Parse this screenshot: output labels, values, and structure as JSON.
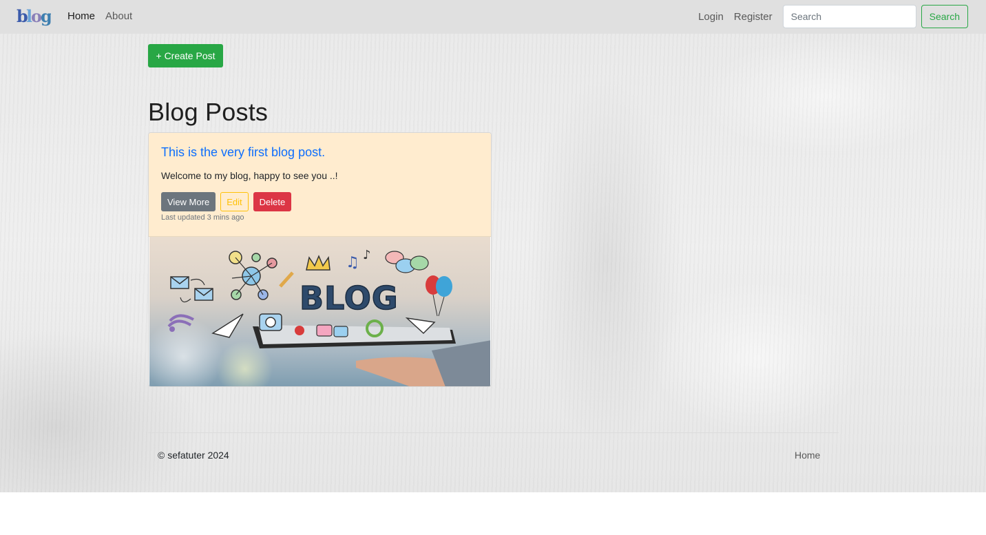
{
  "brand": {
    "logo_text": "blog",
    "logo_colors": [
      "#3b5bab",
      "#e4c44a",
      "#2f6fd0",
      "#d83c3c",
      "#3e9c4a"
    ]
  },
  "nav": {
    "home": "Home",
    "about": "About",
    "login": "Login",
    "register": "Register",
    "search_placeholder": "Search",
    "search_button": "Search"
  },
  "main": {
    "create_button": "+ Create Post",
    "title": "Blog Posts"
  },
  "posts": [
    {
      "title": "This is the very first blog post.",
      "body": "Welcome to my blog, happy to see you ..!",
      "view_more": "View More",
      "edit": "Edit",
      "delete": "Delete",
      "updated": "Last updated 3 mins ago",
      "image_text": "BLOG"
    }
  ],
  "footer": {
    "copyright": "© sefatuter 2024",
    "home": "Home"
  },
  "colors": {
    "success": "#28a745",
    "primary": "#0d6efd",
    "secondary": "#6c757d",
    "warning": "#ffc107",
    "danger": "#dc3545",
    "card_body_bg": "#ffeccf",
    "navbar_bg": "#e0e0e0"
  }
}
